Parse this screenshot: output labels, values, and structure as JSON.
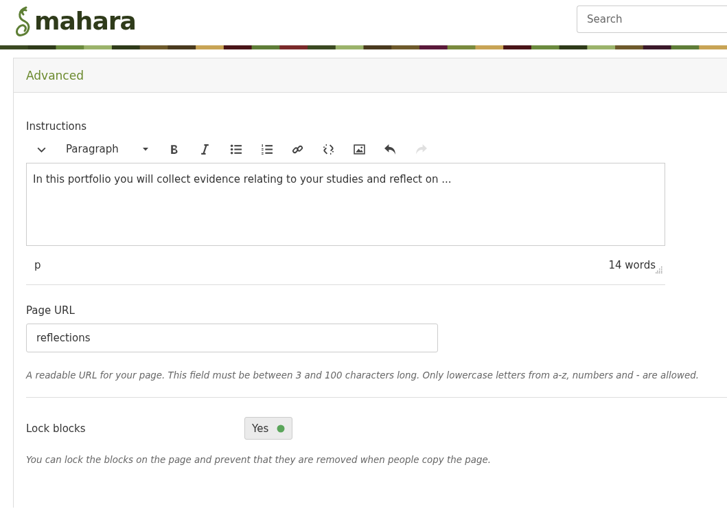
{
  "header": {
    "logo_text": "mahara",
    "search": {
      "placeholder": "Search"
    }
  },
  "panel": {
    "title": "Advanced"
  },
  "instructions": {
    "label": "Instructions",
    "toolbar": [
      {
        "kind": "collapse",
        "disabled": false
      },
      {
        "kind": "format",
        "label": "Paragraph",
        "disabled": false
      },
      {
        "kind": "bold",
        "disabled": false
      },
      {
        "kind": "italic",
        "disabled": false
      },
      {
        "kind": "bullets",
        "disabled": false
      },
      {
        "kind": "numbers",
        "disabled": false
      },
      {
        "kind": "link",
        "disabled": false
      },
      {
        "kind": "unlink",
        "disabled": false
      },
      {
        "kind": "image",
        "disabled": false
      },
      {
        "kind": "undo",
        "disabled": false
      },
      {
        "kind": "redo",
        "disabled": true
      }
    ],
    "value": "In this portfolio you will collect evidence relating to your studies and reflect on ...",
    "path": "p",
    "word_count": "14 words"
  },
  "page_url": {
    "label": "Page URL",
    "value": "reflections",
    "help": "A readable URL for your page. This field must be between 3 and 100 characters long. Only lowercase letters from a-z, numbers and - are allowed."
  },
  "lock_blocks": {
    "label": "Lock blocks",
    "switch_label": "Yes",
    "on": true,
    "help": "You can lock the blocks on the page and prevent that they are removed when people copy the page."
  }
}
